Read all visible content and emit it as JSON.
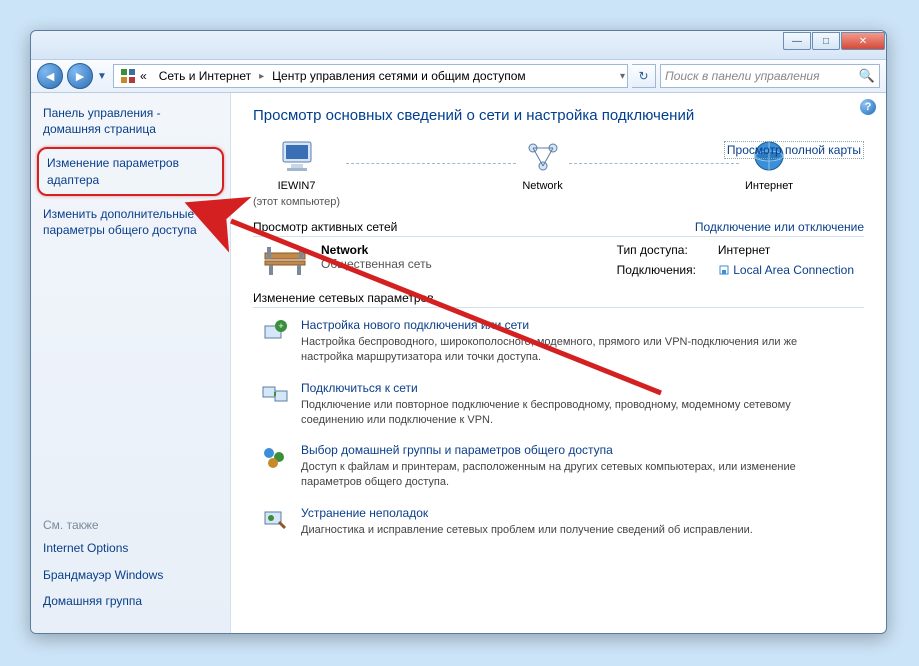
{
  "titlebar": {
    "min": "—",
    "max": "□",
    "close": "✕"
  },
  "nav": {
    "icon": "⚙",
    "seg1_prefix": "«",
    "seg1": "Сеть и Интернет",
    "seg2": "Центр управления сетями и общим доступом",
    "dropdown": "▾",
    "refresh": "↻"
  },
  "search": {
    "placeholder": "Поиск в панели управления",
    "icon": "🔍"
  },
  "sidebar": {
    "home": "Панель управления - домашняя страница",
    "adapter": "Изменение параметров адаптера",
    "sharing": "Изменить дополнительные параметры общего доступа",
    "also_h": "См. также",
    "also": [
      "Internet Options",
      "Брандмауэр Windows",
      "Домашняя группа"
    ]
  },
  "main": {
    "title": "Просмотр основных сведений о сети и настройка подключений",
    "fullmap": "Просмотр полной карты",
    "map": {
      "pc": "IEWIN7",
      "pc_sub": "(этот компьютер)",
      "net": "Network",
      "inet": "Интернет"
    },
    "active_h": "Просмотр активных сетей",
    "active_link": "Подключение или отключение",
    "network": {
      "name": "Network",
      "type": "Общественная сеть"
    },
    "info": {
      "access_lbl": "Тип доступа:",
      "access_val": "Интернет",
      "conn_lbl": "Подключения:",
      "conn_val": "Local Area Connection"
    },
    "change_h": "Изменение сетевых параметров",
    "tasks": [
      {
        "title": "Настройка нового подключения или сети",
        "desc": "Настройка беспроводного, широкополосного, модемного, прямого или VPN-подключения или же настройка маршрутизатора или точки доступа."
      },
      {
        "title": "Подключиться к сети",
        "desc": "Подключение или повторное подключение к беспроводному, проводному, модемному сетевому соединению или подключение к VPN."
      },
      {
        "title": "Выбор домашней группы и параметров общего доступа",
        "desc": "Доступ к файлам и принтерам, расположенным на других сетевых компьютерах, или изменение параметров общего доступа."
      },
      {
        "title": "Устранение неполадок",
        "desc": "Диагностика и исправление сетевых проблем или получение сведений об исправлении."
      }
    ]
  }
}
